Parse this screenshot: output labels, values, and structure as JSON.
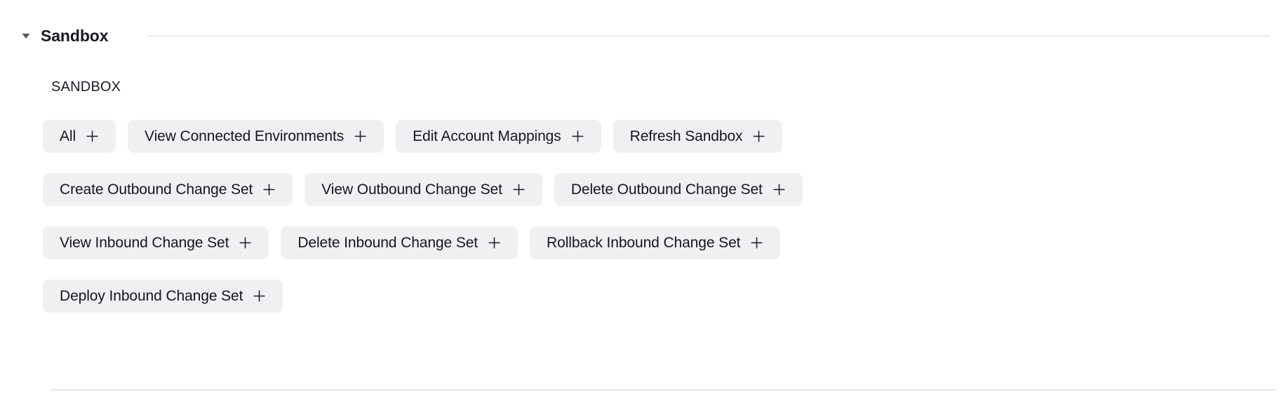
{
  "section": {
    "title": "Sandbox",
    "collapse_icon": "chevron-down-icon",
    "expanded": true
  },
  "group": {
    "label": "SANDBOX"
  },
  "chip_add_icon": "plus-icon",
  "colors": {
    "chip_background": "#f0f0f2",
    "chip_text": "#15151c",
    "rule": "#d8d8dd",
    "title_text": "#181823"
  },
  "rows": [
    {
      "chips": [
        {
          "label": "All"
        },
        {
          "label": "View Connected Environments"
        },
        {
          "label": "Edit Account Mappings"
        },
        {
          "label": "Refresh Sandbox"
        }
      ]
    },
    {
      "chips": [
        {
          "label": "Create Outbound Change Set"
        },
        {
          "label": "View Outbound Change Set"
        },
        {
          "label": "Delete Outbound Change Set"
        }
      ]
    },
    {
      "chips": [
        {
          "label": "View Inbound Change Set"
        },
        {
          "label": "Delete Inbound Change Set"
        },
        {
          "label": "Rollback Inbound Change Set"
        }
      ]
    },
    {
      "chips": [
        {
          "label": "Deploy Inbound Change Set"
        }
      ]
    }
  ]
}
